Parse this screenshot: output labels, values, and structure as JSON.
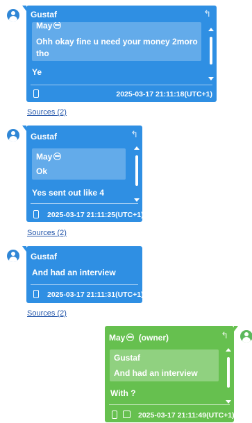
{
  "messages": [
    {
      "sender": "Gustaf",
      "reply_icon": "↰",
      "quote_author": "May",
      "quote_text": "Ohh okay fine u need your money 2moro tho",
      "text": "Ye",
      "timestamp": "2025-03-17 21:11:18(UTC+1)",
      "sources": "Sources (2)"
    },
    {
      "sender": "Gustaf",
      "reply_icon": "↰",
      "quote_author": "May",
      "quote_text": "Ok",
      "text": "Yes sent out like 4",
      "timestamp": "2025-03-17 21:11:25(UTC+1)",
      "sources": "Sources (2)"
    },
    {
      "sender": "Gustaf",
      "text": "And had an interview",
      "timestamp": "2025-03-17 21:11:31(UTC+1)",
      "sources": "Sources (2)"
    },
    {
      "sender": "May",
      "owner_tag": "(owner)",
      "reply_icon": "↰",
      "quote_author": "Gustaf",
      "quote_text": "And had an interview",
      "text": "With ?",
      "timestamp": "2025-03-17 21:11:49(UTC+1)"
    }
  ],
  "colors": {
    "incoming": "#2f8fe3",
    "outgoing": "#66c04f",
    "link": "#2255aa"
  }
}
